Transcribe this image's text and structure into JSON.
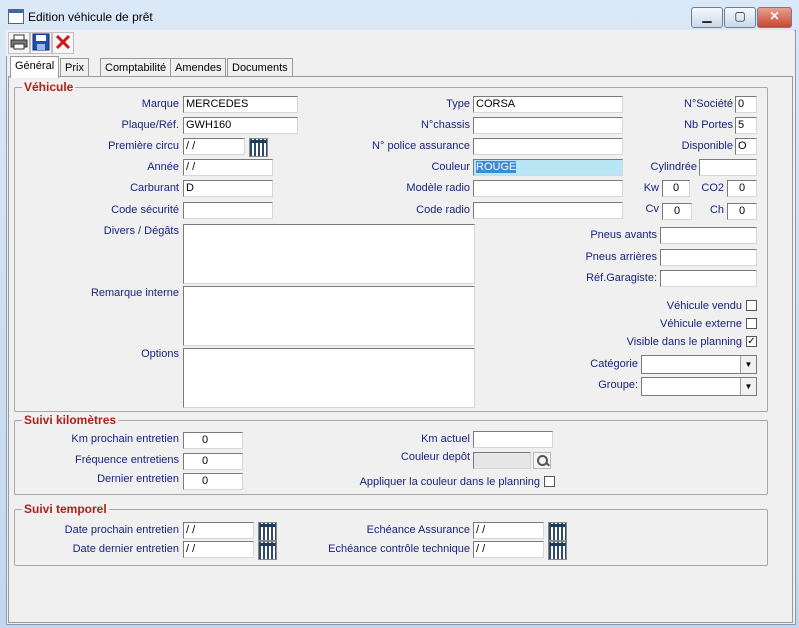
{
  "window": {
    "title": "Edition véhicule de prêt",
    "minimize_label": "▁",
    "maximize_label": "▢",
    "close_label": "✕"
  },
  "toolbar": {
    "print_icon": "printer-icon",
    "save_icon": "floppy-disk-icon",
    "delete_icon": "red-x-icon"
  },
  "tabs": [
    "Général",
    "Prix",
    "Comptabilité",
    "Amendes",
    "Documents"
  ],
  "vehicule": {
    "title": "Véhicule",
    "marque": {
      "label": "Marque",
      "value": "MERCEDES"
    },
    "plaque": {
      "label": "Plaque/Réf.",
      "value": "GWH160"
    },
    "premiere_circu": {
      "label": "Première circu",
      "value": " / /"
    },
    "annee": {
      "label": "Année",
      "value": " / /"
    },
    "carburant": {
      "label": "Carburant",
      "value": "D"
    },
    "code_securite": {
      "label": "Code sécurité",
      "value": ""
    },
    "divers": {
      "label": "Divers / Dégâts"
    },
    "remarque": {
      "label": "Remarque interne"
    },
    "options": {
      "label": "Options"
    },
    "type": {
      "label": "Type",
      "value": "CORSA"
    },
    "nchassis": {
      "label": "N°chassis",
      "value": ""
    },
    "police": {
      "label": "N° police assurance",
      "value": ""
    },
    "couleur": {
      "label": "Couleur",
      "value": "ROUGE"
    },
    "modele_radio": {
      "label": "Modèle radio",
      "value": ""
    },
    "code_radio": {
      "label": "Code radio",
      "value": ""
    },
    "nsociete": {
      "label": "N°Société",
      "value": "0"
    },
    "nb_portes": {
      "label": "Nb Portes",
      "value": "5"
    },
    "disponible": {
      "label": "Disponible",
      "value": "O"
    },
    "cylindree": {
      "label": "Cylindrée",
      "value": ""
    },
    "kw": {
      "label": "Kw",
      "value": "0"
    },
    "co2": {
      "label": "CO2",
      "value": "0"
    },
    "cv": {
      "label": "Cv",
      "value": "0"
    },
    "ch": {
      "label": "Ch",
      "value": "0"
    },
    "pneus_avants": {
      "label": "Pneus avants",
      "value": ""
    },
    "pneus_arrieres": {
      "label": "Pneus arrières",
      "value": ""
    },
    "ref_garagiste": {
      "label": "Réf.Garagiste:",
      "value": ""
    },
    "vendu": {
      "label": "Véhicule vendu",
      "checked": false
    },
    "externe": {
      "label": "Véhicule externe",
      "checked": false
    },
    "visible_planning": {
      "label": "Visible dans le planning",
      "checked": true,
      "mark": "✓"
    },
    "categorie": {
      "label": "Catégorie",
      "value": ""
    },
    "groupe": {
      "label": "Groupe:",
      "value": ""
    }
  },
  "km": {
    "title": "Suivi kilomètres",
    "km_prochain": {
      "label": "Km prochain entretien",
      "value": "0"
    },
    "frequence": {
      "label": "Fréquence entretiens",
      "value": "0"
    },
    "dernier": {
      "label": "Dernier entretien",
      "value": "0"
    },
    "km_actuel": {
      "label": "Km actuel",
      "value": ""
    },
    "couleur_depot": {
      "label": "Couleur depôt",
      "value": ""
    },
    "appliquer": {
      "label": "Appliquer la couleur dans le planning",
      "checked": false
    }
  },
  "temporel": {
    "title": "Suivi temporel",
    "date_prochain": {
      "label": "Date prochain entretien",
      "value": " / /"
    },
    "date_dernier": {
      "label": "Date dernier entretien",
      "value": " / /"
    },
    "echeance_assurance": {
      "label": "Echéance Assurance",
      "value": " / /"
    },
    "echeance_controle": {
      "label": "Echéance contrôle technique",
      "value": " / /"
    }
  },
  "colors": {
    "label": "#1a237e",
    "group_title": "#b0201a",
    "selected_field": "#b8e6f4",
    "disabled_field": "#e6e6e6"
  }
}
